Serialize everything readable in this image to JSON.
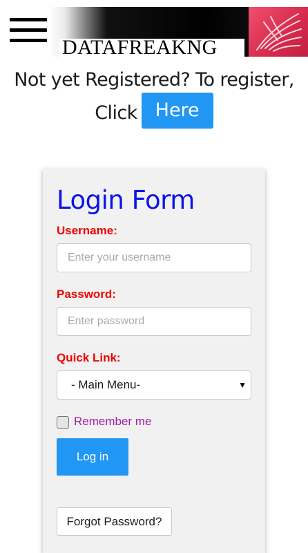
{
  "header": {
    "menu_icon": "hamburger-menu-icon",
    "logo_text": "DATAFREAKNG",
    "logo_colors": {
      "dark": "#000000",
      "accent": "#d62a4d"
    }
  },
  "register": {
    "line1": "Not yet Registered? To register,",
    "line2": "Click",
    "button_label": "Here"
  },
  "login_form": {
    "title": "Login Form",
    "username_label": "Username:",
    "username_placeholder": "Enter your username",
    "password_label": "Password:",
    "password_placeholder": "Enter password",
    "quicklink_label": "Quick Link:",
    "quicklink_selected": "- Main Menu-",
    "remember_label": "Remember me",
    "remember_checked": false,
    "login_button": "Log in",
    "forgot_button": "Forgot Password?"
  },
  "colors": {
    "primary_button": "#2196f3",
    "title": "#0a14e8",
    "labels": "#ee0000",
    "remember_text": "#a020a8"
  }
}
